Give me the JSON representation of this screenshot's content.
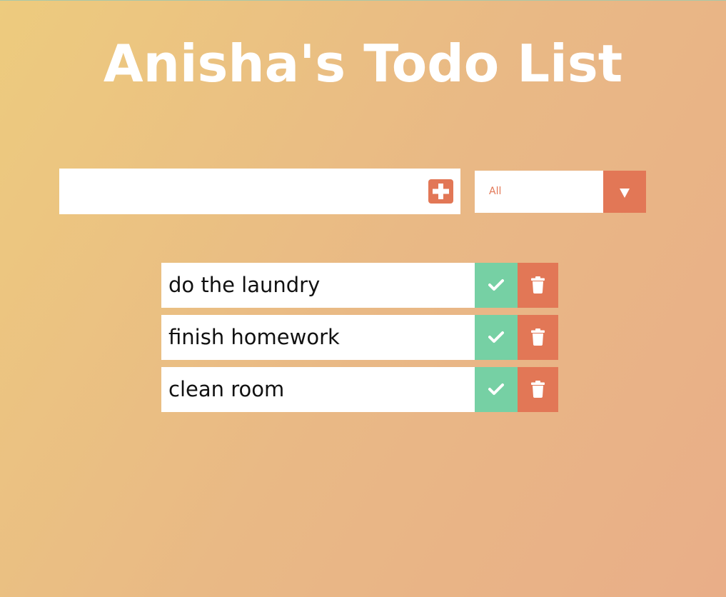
{
  "title": "Anisha's Todo List",
  "form": {
    "input_value": "",
    "add_icon": "plus-square-icon"
  },
  "filter": {
    "selected": "All",
    "arrow_icon": "caret-down-icon"
  },
  "todos": [
    {
      "text": "do the laundry"
    },
    {
      "text": "finish homework"
    },
    {
      "text": "clean room"
    }
  ],
  "icons": {
    "complete": "check-icon",
    "delete": "trash-icon"
  },
  "colors": {
    "accent": "#e27756",
    "complete": "#76d0a4",
    "background_start": "#edcb7e",
    "background_end": "#e9ae88"
  }
}
